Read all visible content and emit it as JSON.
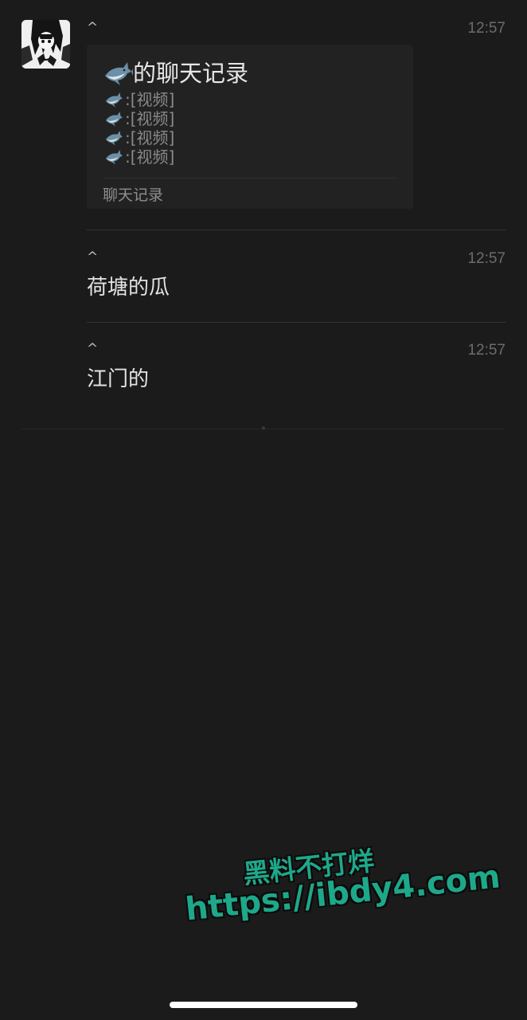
{
  "messages": [
    {
      "caret": "^",
      "time": "12:57",
      "type": "chat_record_card",
      "card": {
        "title": "的聊天记录",
        "lines": [
          {
            "sender_icon": "shark-emoji",
            "text": ":[视频]"
          },
          {
            "sender_icon": "shark-emoji",
            "text": ":[视频]"
          },
          {
            "sender_icon": "shark-emoji",
            "text": ":[视频]"
          },
          {
            "sender_icon": "shark-emoji",
            "text": ":[视频]"
          }
        ],
        "footer": "聊天记录"
      }
    },
    {
      "caret": "^",
      "time": "12:57",
      "type": "text",
      "text": "荷塘的瓜"
    },
    {
      "caret": "^",
      "time": "12:57",
      "type": "text",
      "text": "江门的"
    }
  ],
  "watermark": {
    "line1": "黑料不打烊",
    "line2": "https://ibdy4.com",
    "color": "#1ea88a"
  },
  "colors": {
    "background": "#1b1b1b",
    "card": "#222222",
    "time": "#6c6c6c"
  }
}
